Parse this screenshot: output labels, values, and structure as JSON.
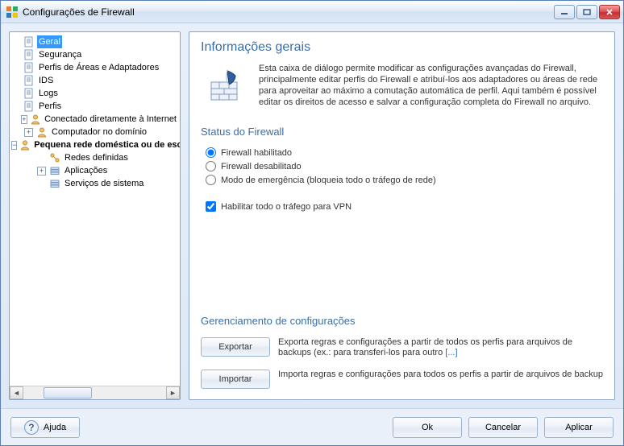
{
  "window": {
    "title": "Configurações de Firewall"
  },
  "tree": {
    "items": [
      {
        "label": "Geral",
        "depth": 0,
        "toggle": null,
        "icon": "page",
        "selected": true
      },
      {
        "label": "Segurança",
        "depth": 0,
        "toggle": null,
        "icon": "page"
      },
      {
        "label": "Perfis de Áreas e Adaptadores",
        "depth": 0,
        "toggle": null,
        "icon": "page"
      },
      {
        "label": "IDS",
        "depth": 0,
        "toggle": null,
        "icon": "page"
      },
      {
        "label": "Logs",
        "depth": 0,
        "toggle": null,
        "icon": "page"
      },
      {
        "label": "Perfis",
        "depth": 0,
        "toggle": null,
        "icon": "page"
      },
      {
        "label": "Conectado diretamente à Internet",
        "depth": 1,
        "toggle": "plus",
        "icon": "user"
      },
      {
        "label": "Computador no domínio",
        "depth": 1,
        "toggle": "plus",
        "icon": "user"
      },
      {
        "label": "Pequena rede doméstica ou de escritório",
        "depth": 1,
        "toggle": "minus",
        "icon": "user",
        "bold": true
      },
      {
        "label": "Redes definidas",
        "depth": 2,
        "toggle": null,
        "icon": "net"
      },
      {
        "label": "Aplicações",
        "depth": 2,
        "toggle": "plus",
        "icon": "stack"
      },
      {
        "label": "Serviços de sistema",
        "depth": 2,
        "toggle": null,
        "icon": "stack"
      }
    ]
  },
  "main": {
    "title": "Informações gerais",
    "description": "Esta caixa de diálogo permite modificar as configurações avançadas do Firewall, principalmente editar perfis do Firewall e atribuí-los aos adaptadores ou áreas de rede para aproveitar ao máximo a comutação automática de perfil. Aqui também é possível editar os direitos de acesso e salvar a configuração completa do Firewall no arquivo.",
    "status_heading": "Status do Firewall",
    "radios": [
      {
        "label": "Firewall habilitado",
        "checked": true
      },
      {
        "label": "Firewall desabilitado",
        "checked": false
      },
      {
        "label": "Modo de emergência (bloqueia todo o tráfego de rede)",
        "checked": false
      }
    ],
    "vpn_checkbox": {
      "label": "Habilitar todo o tráfego para VPN",
      "checked": true
    },
    "mgmt_heading": "Gerenciamento de configurações",
    "export_btn": "Exportar",
    "export_text": "Exporta regras e configurações a partir de todos os perfis para arquivos de backups (ex.: para transferi-los para outro ",
    "export_link": "[...]",
    "import_btn": "Importar",
    "import_text": "Importa regras e configurações para todos os perfis a partir de arquivos de backup"
  },
  "footer": {
    "help": "Ajuda",
    "ok": "Ok",
    "cancel": "Cancelar",
    "apply": "Aplicar"
  }
}
